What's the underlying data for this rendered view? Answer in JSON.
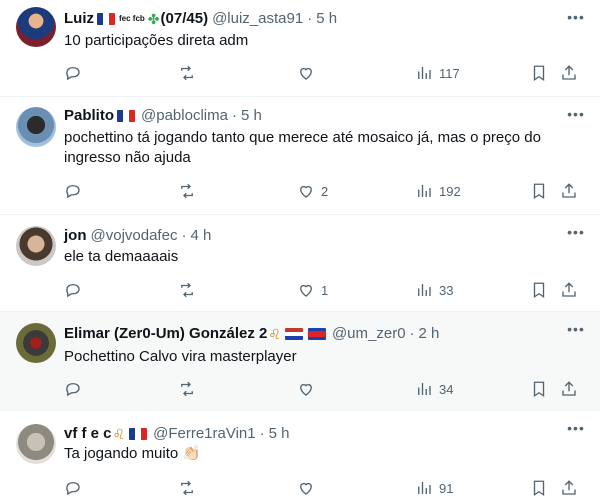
{
  "tweets": [
    {
      "name": "Luiz",
      "name_extra": "fec fcb",
      "count_label": "(07/45)",
      "handle": "@luiz_asta91",
      "time": "5 h",
      "text": "10 participações direta adm",
      "stats": {
        "replies": "",
        "retweets": "",
        "likes": "",
        "views": "117"
      }
    },
    {
      "name": "Pablito",
      "handle": "@pabloclima",
      "time": "5 h",
      "text": "pochettino tá jogando tanto que merece até mosaico já, mas o preço do ingresso não ajuda",
      "stats": {
        "replies": "",
        "retweets": "",
        "likes": "2",
        "views": "192"
      }
    },
    {
      "name": "jon",
      "handle": "@vojvodafec",
      "time": "4 h",
      "text": "ele ta demaaaais",
      "stats": {
        "replies": "",
        "retweets": "",
        "likes": "1",
        "views": "33"
      }
    },
    {
      "name": "Elimar (Zer0-Um) González 2",
      "handle": "@um_zer0",
      "time": "2 h",
      "text": "Pochettino Calvo vira masterplayer",
      "stats": {
        "replies": "",
        "retweets": "",
        "likes": "",
        "views": "34"
      }
    },
    {
      "name": "vf f e c",
      "handle": "@Ferre1raVin1",
      "time": "5 h",
      "text": "Ta jogando muito 👏🏻",
      "stats": {
        "replies": "",
        "retweets": "",
        "likes": "",
        "views": "91"
      }
    }
  ],
  "separator": "·",
  "icons": {
    "more": "more-dots-icon",
    "reply": "reply-icon",
    "retweet": "retweet-icon",
    "like": "heart-icon",
    "views": "views-chart-icon",
    "bookmark": "bookmark-icon",
    "share": "share-icon"
  },
  "colors": {
    "text": "#0f1419",
    "muted": "#536471",
    "divider": "#eff3f4",
    "highlight_bg": "#f7f9f9"
  }
}
